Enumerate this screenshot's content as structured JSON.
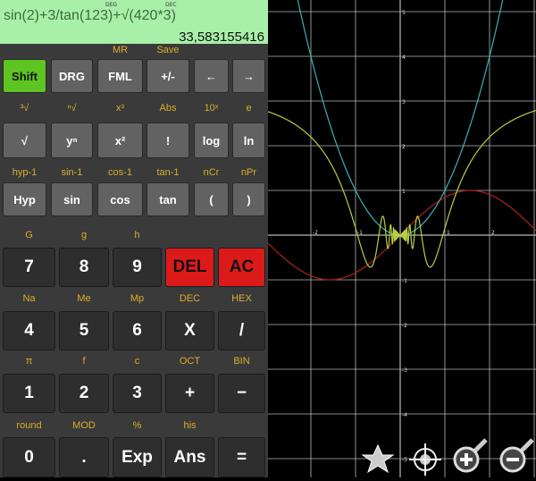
{
  "display": {
    "deg": "DEG",
    "dec": "DEC",
    "expression": "sin(2)+3/tan(123)+√(420*3)",
    "result": "33,583155416"
  },
  "rows": [
    {
      "labels": [
        "",
        "",
        "MR",
        "Save",
        "",
        ""
      ],
      "keys": [
        "Shift",
        "DRG",
        "FML",
        "+/-",
        "←",
        "→"
      ]
    },
    {
      "labels": [
        "³√",
        "ⁿ√",
        "x³",
        "Abs",
        "10ˣ",
        "e"
      ],
      "keys": [
        "√",
        "yⁿ",
        "x²",
        "!",
        "log",
        "ln"
      ]
    },
    {
      "labels": [
        "hyp-1",
        "sin-1",
        "cos-1",
        "tan-1",
        "nCr",
        "nPr"
      ],
      "keys": [
        "Hyp",
        "sin",
        "cos",
        "tan",
        "(",
        ")"
      ]
    },
    {
      "labels": [
        "G",
        "g",
        "h",
        "",
        ""
      ],
      "keys": [
        "7",
        "8",
        "9",
        "DEL",
        "AC"
      ]
    },
    {
      "labels": [
        "Na",
        "Me",
        "Mp",
        "DEC",
        "HEX"
      ],
      "keys": [
        "4",
        "5",
        "6",
        "X",
        "/"
      ]
    },
    {
      "labels": [
        "π",
        "f",
        "c",
        "OCT",
        "BIN"
      ],
      "keys": [
        "1",
        "2",
        "3",
        "+",
        "−"
      ]
    },
    {
      "labels": [
        "round",
        "MOD",
        "%",
        "his",
        ""
      ],
      "keys": [
        "0",
        ".",
        "Exp",
        "Ans",
        "="
      ]
    }
  ],
  "graph": {
    "x_ticks": [
      "-2",
      "-1",
      "1",
      "2"
    ],
    "y_ticks": [
      "5",
      "4",
      "3",
      "2",
      "1",
      "-1",
      "-2",
      "-3",
      "-4",
      "-5"
    ],
    "colors": {
      "sin": "#b02020",
      "square": "#3ab0b8",
      "osc": "#b8d040",
      "grid": "#b8b8b8"
    },
    "toolbar": [
      "favorites-star",
      "center-target",
      "zoom-in",
      "zoom-out"
    ]
  }
}
